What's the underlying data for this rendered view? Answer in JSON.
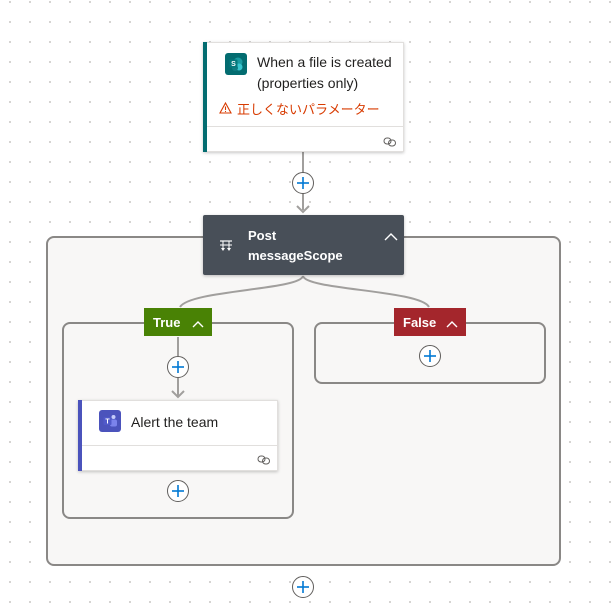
{
  "trigger": {
    "title_line1": "When a file is created",
    "title_line2": "(properties only)",
    "icon": "sharepoint-icon",
    "warning_icon": "warning-icon",
    "warning_text": "正しくないパラメーター",
    "footer_icon": "link-icon",
    "accent_color": "#036c70"
  },
  "scope": {
    "icon": "scope-icon",
    "title_line1": "Post",
    "title_line2": "messageScope",
    "collapse_icon": "chevron-up-icon",
    "header_color": "#484f58"
  },
  "branches": {
    "true": {
      "label": "True",
      "color": "#498205",
      "collapse_icon": "chevron-up-icon"
    },
    "false": {
      "label": "False",
      "color": "#a4262c",
      "collapse_icon": "chevron-up-icon"
    }
  },
  "actions": [
    {
      "title": "Alert the team",
      "icon": "teams-icon",
      "footer_icon": "link-icon",
      "accent_color": "#4b53bc"
    }
  ],
  "add_step_buttons": [
    {
      "name": "insert-step-after-trigger"
    },
    {
      "name": "add-action-true-top"
    },
    {
      "name": "add-action-true-bottom"
    },
    {
      "name": "add-action-false"
    },
    {
      "name": "add-step-end"
    }
  ]
}
